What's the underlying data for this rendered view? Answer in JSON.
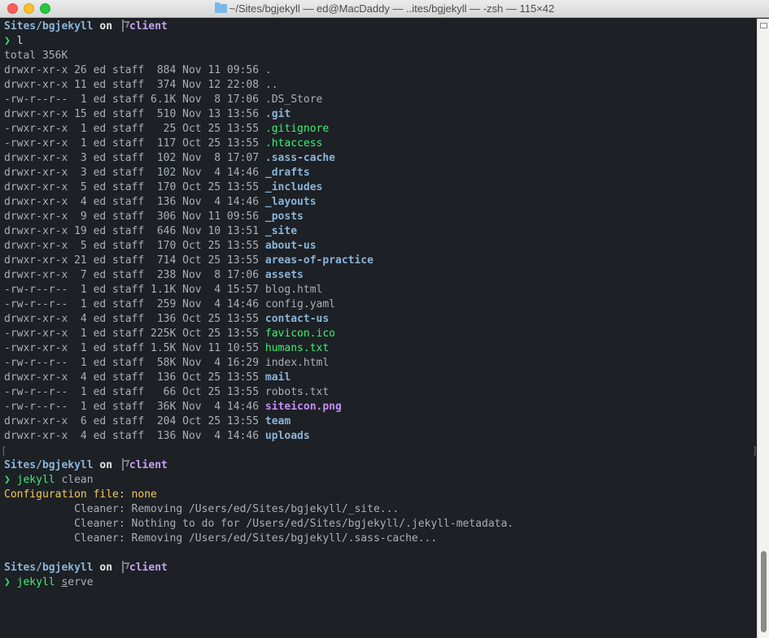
{
  "window": {
    "title": "~/Sites/bgjekyll — ed@MacDaddy — ..ites/bgjekyll — -zsh — 115×42"
  },
  "prompt": {
    "path": "Sites/bgjekyll",
    "on": "on",
    "branch": "client",
    "symbol": "❯"
  },
  "session1": {
    "command": "l",
    "total": "total 356K",
    "listing": [
      {
        "meta": "drwxr-xr-x 26 ed staff  884 Nov 11 09:56 ",
        "name": ".",
        "kind": "plain"
      },
      {
        "meta": "drwxr-xr-x 11 ed staff  374 Nov 12 22:08 ",
        "name": "..",
        "kind": "plain"
      },
      {
        "meta": "-rw-r--r--  1 ed staff 6.1K Nov  8 17:06 ",
        "name": ".DS_Store",
        "kind": "plain"
      },
      {
        "meta": "drwxr-xr-x 15 ed staff  510 Nov 13 13:56 ",
        "name": ".git",
        "kind": "dir"
      },
      {
        "meta": "-rwxr-xr-x  1 ed staff   25 Oct 25 13:55 ",
        "name": ".gitignore",
        "kind": "exec"
      },
      {
        "meta": "-rwxr-xr-x  1 ed staff  117 Oct 25 13:55 ",
        "name": ".htaccess",
        "kind": "exec"
      },
      {
        "meta": "drwxr-xr-x  3 ed staff  102 Nov  8 17:07 ",
        "name": ".sass-cache",
        "kind": "dir"
      },
      {
        "meta": "drwxr-xr-x  3 ed staff  102 Nov  4 14:46 ",
        "name": "_drafts",
        "kind": "dir"
      },
      {
        "meta": "drwxr-xr-x  5 ed staff  170 Oct 25 13:55 ",
        "name": "_includes",
        "kind": "dir"
      },
      {
        "meta": "drwxr-xr-x  4 ed staff  136 Nov  4 14:46 ",
        "name": "_layouts",
        "kind": "dir"
      },
      {
        "meta": "drwxr-xr-x  9 ed staff  306 Nov 11 09:56 ",
        "name": "_posts",
        "kind": "dir"
      },
      {
        "meta": "drwxr-xr-x 19 ed staff  646 Nov 10 13:51 ",
        "name": "_site",
        "kind": "dir"
      },
      {
        "meta": "drwxr-xr-x  5 ed staff  170 Oct 25 13:55 ",
        "name": "about-us",
        "kind": "dir"
      },
      {
        "meta": "drwxr-xr-x 21 ed staff  714 Oct 25 13:55 ",
        "name": "areas-of-practice",
        "kind": "dir"
      },
      {
        "meta": "drwxr-xr-x  7 ed staff  238 Nov  8 17:06 ",
        "name": "assets",
        "kind": "dir"
      },
      {
        "meta": "-rw-r--r--  1 ed staff 1.1K Nov  4 15:57 ",
        "name": "blog.html",
        "kind": "plain"
      },
      {
        "meta": "-rw-r--r--  1 ed staff  259 Nov  4 14:46 ",
        "name": "config.yaml",
        "kind": "plain"
      },
      {
        "meta": "drwxr-xr-x  4 ed staff  136 Oct 25 13:55 ",
        "name": "contact-us",
        "kind": "dir"
      },
      {
        "meta": "-rwxr-xr-x  1 ed staff 225K Oct 25 13:55 ",
        "name": "favicon.ico",
        "kind": "exec"
      },
      {
        "meta": "-rwxr-xr-x  1 ed staff 1.5K Nov 11 10:55 ",
        "name": "humans.txt",
        "kind": "exec"
      },
      {
        "meta": "-rw-r--r--  1 ed staff  58K Nov  4 16:29 ",
        "name": "index.html",
        "kind": "plain"
      },
      {
        "meta": "drwxr-xr-x  4 ed staff  136 Oct 25 13:55 ",
        "name": "mail",
        "kind": "dir"
      },
      {
        "meta": "-rw-r--r--  1 ed staff   66 Oct 25 13:55 ",
        "name": "robots.txt",
        "kind": "plain"
      },
      {
        "meta": "-rw-r--r--  1 ed staff  36K Nov  4 14:46 ",
        "name": "siteicon.png",
        "kind": "img"
      },
      {
        "meta": "drwxr-xr-x  6 ed staff  204 Oct 25 13:55 ",
        "name": "team",
        "kind": "dir"
      },
      {
        "meta": "drwxr-xr-x  4 ed staff  136 Nov  4 14:46 ",
        "name": "uploads",
        "kind": "dir"
      }
    ]
  },
  "session2": {
    "command": "jekyll",
    "arg": " clean",
    "config_label": "Configuration file:",
    "config_value": " none",
    "output": [
      "           Cleaner: Removing /Users/ed/Sites/bgjekyll/_site...",
      "           Cleaner: Nothing to do for /Users/ed/Sites/bgjekyll/.jekyll-metadata.",
      "           Cleaner: Removing /Users/ed/Sites/bgjekyll/.sass-cache..."
    ]
  },
  "session3": {
    "command": "jekyll",
    "arg_cursor_char": "s",
    "arg_rest": "erve"
  },
  "colors": {
    "background": "#1d2025",
    "path": "#8ab4d8",
    "branch": "#c4a2f2",
    "prompt": "#33e07a",
    "exec": "#3cef74",
    "image": "#c48cf5",
    "warning": "#f2c95c"
  }
}
